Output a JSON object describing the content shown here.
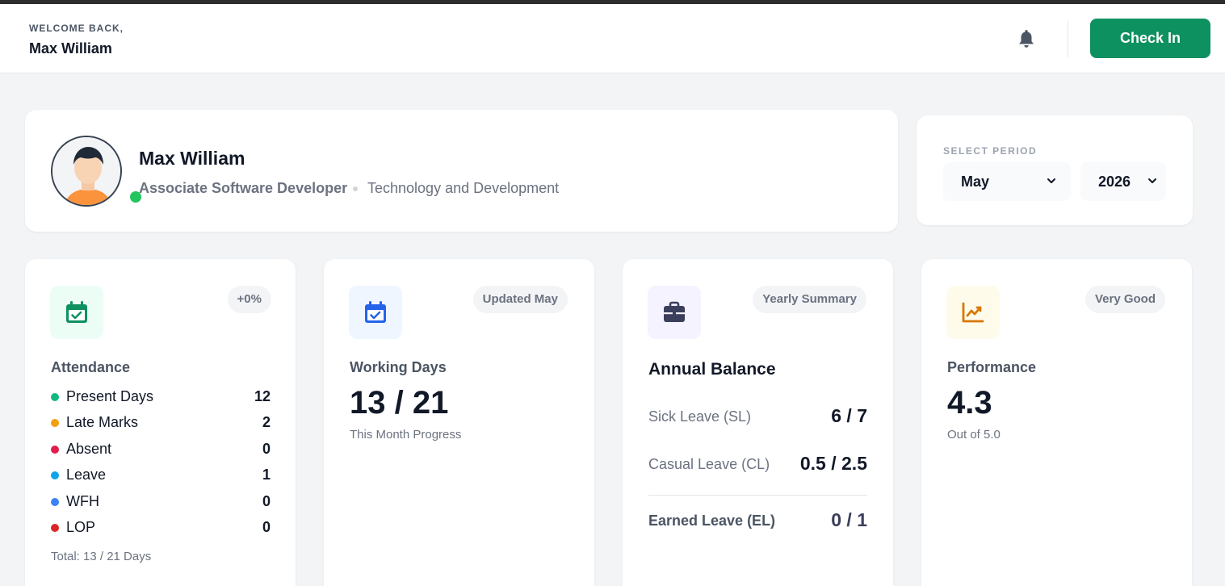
{
  "header": {
    "welcome_label": "WELCOME BACK,",
    "user_name": "Max William",
    "check_in_label": "Check In",
    "bell_icon": "bell-icon"
  },
  "profile": {
    "name": "Max William",
    "role": "Associate Software Developer",
    "department": "Technology and Development",
    "online": true
  },
  "period": {
    "label": "SELECT PERIOD",
    "month": "May",
    "year": "2026"
  },
  "attendance": {
    "badge": "+0%",
    "title": "Attendance",
    "items": [
      {
        "label": "Present Days",
        "value": "12",
        "color": "#10b981"
      },
      {
        "label": "Late Marks",
        "value": "2",
        "color": "#f59e0b"
      },
      {
        "label": "Absent",
        "value": "0",
        "color": "#e11d48"
      },
      {
        "label": "Leave",
        "value": "1",
        "color": "#0ea5e9"
      },
      {
        "label": "WFH",
        "value": "0",
        "color": "#3b82f6"
      },
      {
        "label": "LOP",
        "value": "0",
        "color": "#dc2626"
      }
    ],
    "total": "Total: 13 / 21 Days"
  },
  "working_days": {
    "badge": "Updated May",
    "title": "Working Days",
    "value": "13 / 21",
    "note": "This Month Progress"
  },
  "annual_balance": {
    "badge": "Yearly Summary",
    "title": "Annual Balance",
    "leaves": [
      {
        "label": "Sick Leave (SL)",
        "value": "6 / 7"
      },
      {
        "label": "Casual Leave (CL)",
        "value": "0.5 / 2.5"
      },
      {
        "label": "Earned Leave (EL)",
        "value": "0 / 1"
      }
    ]
  },
  "performance": {
    "badge": "Very Good",
    "title": "Performance",
    "value": "4.3",
    "note": "Out of 5.0"
  },
  "colors": {
    "accent_green": "#0e9160",
    "online": "#22c55e",
    "attendance_icon_bg": "#ecfdf5",
    "working_icon_bg": "#eff6ff",
    "balance_icon_bg": "#f5f3ff",
    "performance_icon_bg": "#fffbeb"
  }
}
